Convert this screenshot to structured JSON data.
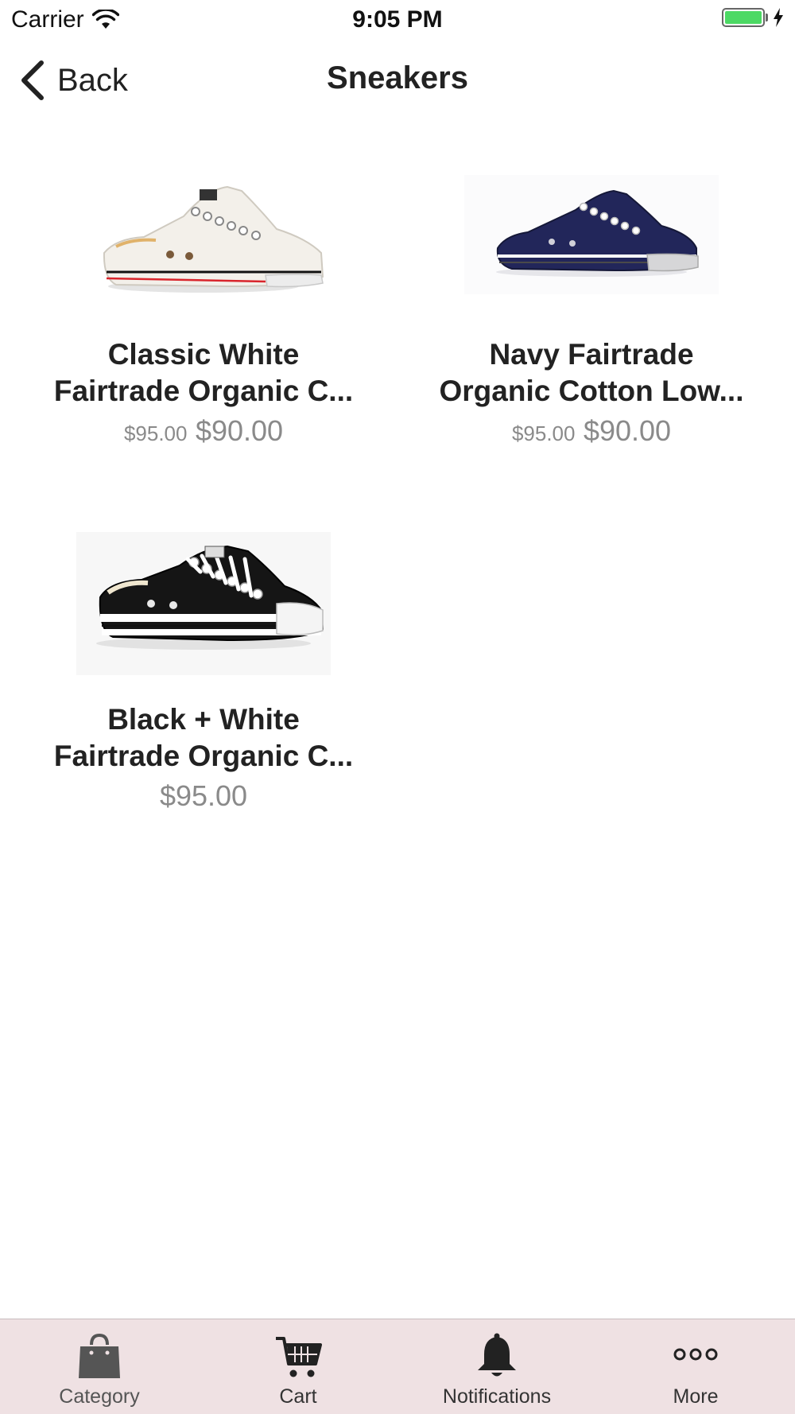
{
  "status_bar": {
    "carrier": "Carrier",
    "time": "9:05 PM",
    "battery_color": "#4cd964"
  },
  "nav": {
    "back_label": "Back",
    "title": "Sneakers"
  },
  "products": [
    {
      "name": "Classic White\nFairtrade Organic C...",
      "old_price": "$95.00",
      "price": "$90.00",
      "shoe_color": "#f2efea"
    },
    {
      "name": "Navy Fairtrade\nOrganic Cotton Low...",
      "old_price": "$95.00",
      "price": "$90.00",
      "shoe_color": "#1f2250"
    },
    {
      "name": "Black + White\nFairtrade Organic C...",
      "old_price": "",
      "price": "$95.00",
      "shoe_color": "#111111"
    }
  ],
  "tab_bar": {
    "background": "#efe1e3",
    "items": [
      {
        "label": "Category",
        "icon": "shopping-bag-icon"
      },
      {
        "label": "Cart",
        "icon": "cart-icon"
      },
      {
        "label": "Notifications",
        "icon": "bell-icon"
      },
      {
        "label": "More",
        "icon": "more-dots-icon"
      }
    ]
  }
}
